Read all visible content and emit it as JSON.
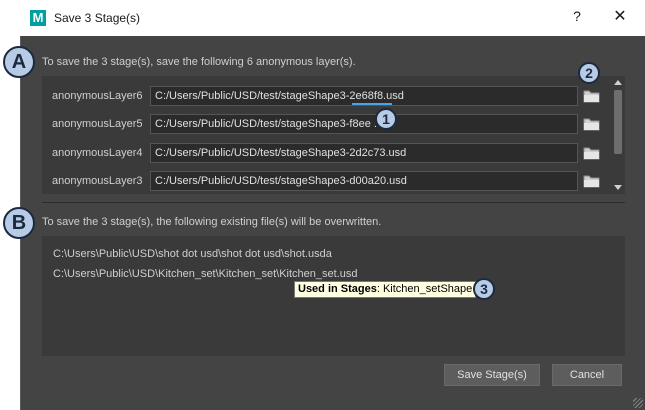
{
  "window": {
    "title": "Save 3 Stage(s)",
    "app_icon_letter": "M",
    "help_label": "?",
    "close_label": "✕"
  },
  "sections": {
    "anonymous_heading": "To save the 3 stage(s), save the following 6 anonymous layer(s).",
    "overwrite_heading": "To save the 3 stage(s), the following existing file(s) will be overwritten."
  },
  "layers": [
    {
      "name": "anonymousLayer6",
      "path": "C:/Users/Public/USD/test/stageShape3-2e68f8.usd"
    },
    {
      "name": "anonymousLayer5",
      "path": "C:/Users/Public/USD/test/stageShape3-f8ee      .usd"
    },
    {
      "name": "anonymousLayer4",
      "path": "C:/Users/Public/USD/test/stageShape3-2d2c73.usd"
    },
    {
      "name": "anonymousLayer3",
      "path": "C:/Users/Public/USD/test/stageShape3-d00a20.usd"
    }
  ],
  "overwrite_files": [
    "C:\\Users\\Public\\USD\\shot dot usd\\shot dot usd\\shot.usda",
    "C:\\Users\\Public\\USD\\Kitchen_set\\Kitchen_set\\Kitchen_set.usd"
  ],
  "tooltip": {
    "label": "Used in Stages",
    "value": ": Kitchen_setShape"
  },
  "buttons": {
    "save": "Save Stage(s)",
    "cancel": "Cancel"
  },
  "callouts": {
    "a": "A",
    "b": "B",
    "one": "1",
    "two": "2",
    "three": "3"
  },
  "colors": {
    "dialog_bg": "#444444",
    "panel_bg": "#3a3a3a",
    "callout_fill": "#b7cbe6",
    "tooltip_bg": "#ffffe1",
    "highlight": "#4aa3e8"
  },
  "icons": {
    "folder": "folder-icon",
    "app": "maya-app-icon",
    "close": "close-icon",
    "help": "help-icon"
  }
}
